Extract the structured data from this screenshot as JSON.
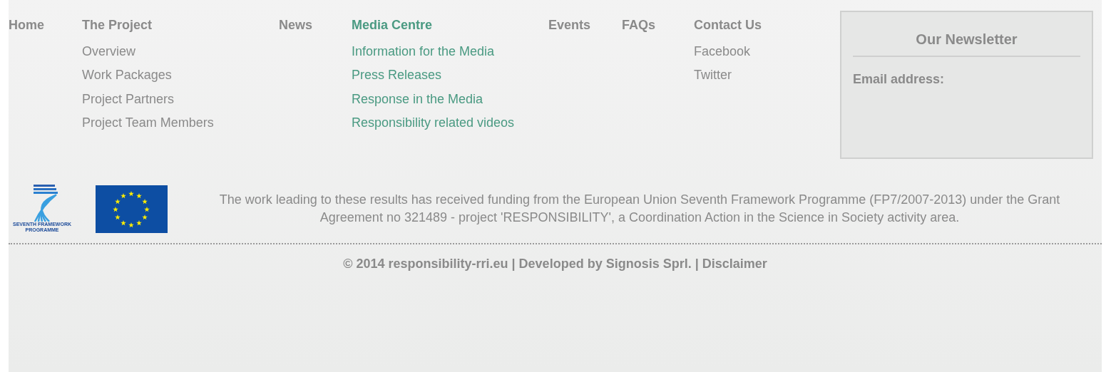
{
  "menu": [
    {
      "label": "Home",
      "selected": false
    },
    {
      "label": "The Project",
      "selected": false,
      "children": [
        "Overview",
        "Work Packages",
        "Project Partners",
        "Project Team Members"
      ]
    },
    {
      "label": "News",
      "selected": false
    },
    {
      "label": "Media Centre",
      "selected": true,
      "children": [
        "Information for the Media",
        "Press Releases",
        "Response in the Media",
        "Responsibility related videos"
      ]
    },
    {
      "label": "Events",
      "selected": false
    },
    {
      "label": "FAQs",
      "selected": false
    },
    {
      "label": "Contact Us",
      "selected": false,
      "children": [
        "Facebook",
        "Twitter"
      ]
    }
  ],
  "newsletter": {
    "title": "Our Newsletter",
    "email_label": "Email address:"
  },
  "fp7_logo": {
    "line_1": "SEVENTH FRAMEWORK",
    "line_2": "PROGRAMME"
  },
  "funding_text": "The work leading to these results has received funding from the European Union Seventh Framework Programme (FP7/2007-2013) under the Grant Agreement no 321489 - project 'RESPONSIBILITY', a Coordination Action in the Science in Society activity area.",
  "copyright": "© 2014 responsibility-rri.eu | Developed by Signosis Sprl. | Disclaimer"
}
